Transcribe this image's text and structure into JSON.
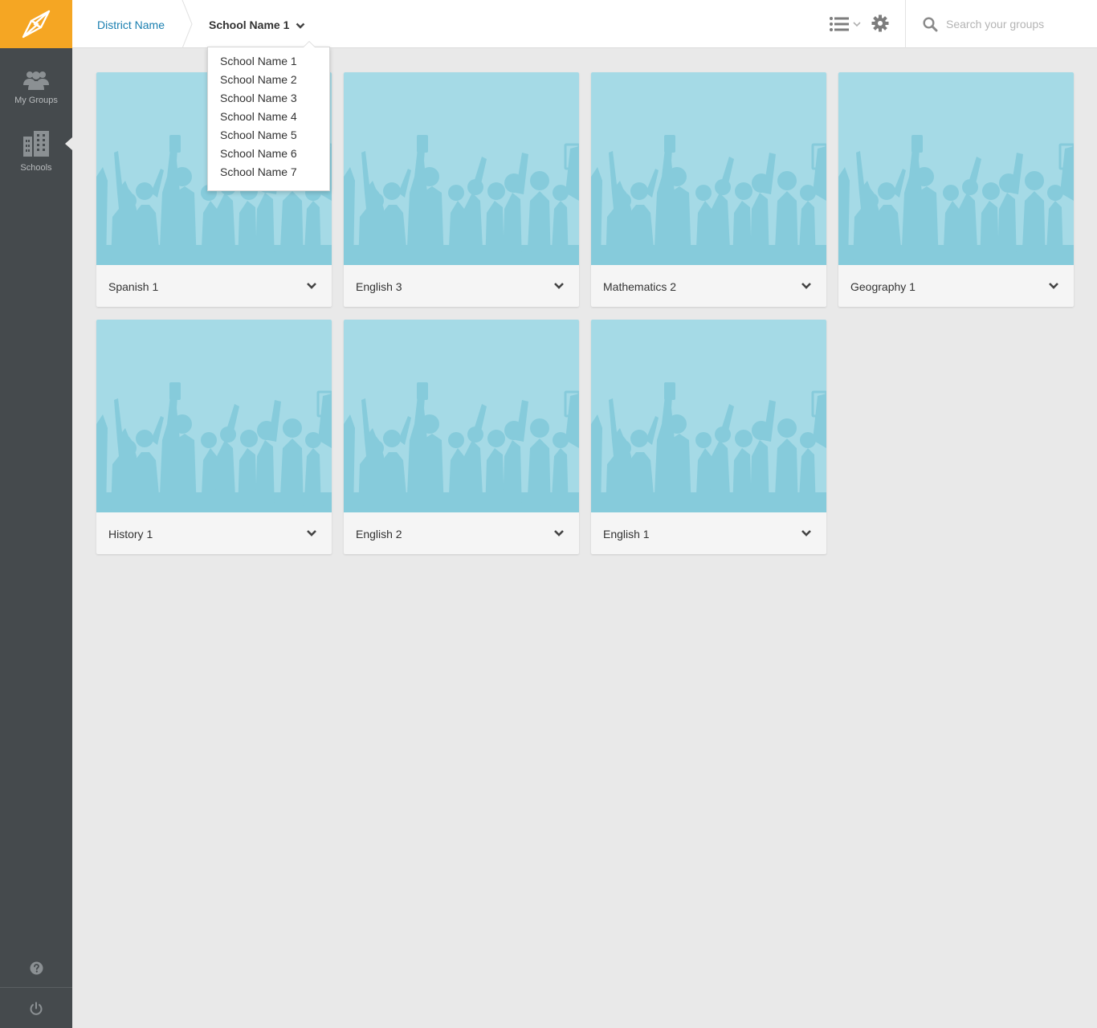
{
  "sidebar": {
    "nav": [
      {
        "label": "My Groups",
        "icon": "users-icon"
      },
      {
        "label": "Schools",
        "icon": "building-icon"
      }
    ],
    "help_icon": "help-icon",
    "power_icon": "power-icon"
  },
  "topbar": {
    "breadcrumb_district": "District Name",
    "breadcrumb_school": "School Name 1",
    "search_placeholder": "Search your groups"
  },
  "school_dropdown": {
    "options": [
      "School Name 1",
      "School Name 2",
      "School Name 3",
      "School Name 4",
      "School Name 5",
      "School Name 6",
      "School Name 7"
    ]
  },
  "groups": [
    {
      "name": "Spanish 1"
    },
    {
      "name": "English 3"
    },
    {
      "name": "Mathematics 2"
    },
    {
      "name": "Geography 1"
    },
    {
      "name": "History 1"
    },
    {
      "name": "English 2"
    },
    {
      "name": "English 1"
    }
  ],
  "colors": {
    "brand": "#f5a623",
    "sidebar": "#454a4d",
    "link": "#1a7fb0",
    "card_image": "#a5dae6",
    "silhouette": "#86cbdb"
  }
}
